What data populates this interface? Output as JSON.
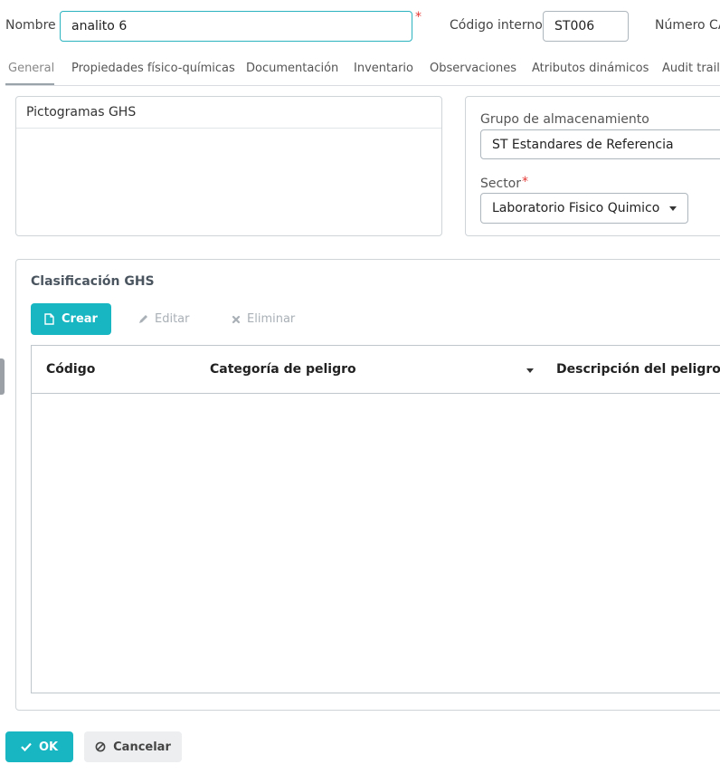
{
  "form": {
    "nombre_label": "Nombre",
    "nombre_value": "analito 6",
    "required_mark": "*",
    "codigo_label": "Código interno",
    "codigo_value": "ST006",
    "numero_label": "Número CA"
  },
  "tabs": [
    {
      "label": "General",
      "active": true
    },
    {
      "label": "Propiedades físico-químicas"
    },
    {
      "label": "Documentación"
    },
    {
      "label": "Inventario"
    },
    {
      "label": "Observaciones"
    },
    {
      "label": "Atributos dinámicos"
    },
    {
      "label": "Audit trail"
    }
  ],
  "pictogramas": {
    "title": "Pictogramas GHS"
  },
  "almacenamiento": {
    "grupo_label": "Grupo de almacenamiento",
    "grupo_value": "ST Estandares de Referencia",
    "sector_label": "Sector",
    "sector_required": "*",
    "sector_value": "Laboratorio Fisico Quimico"
  },
  "clasificacion": {
    "title": "Clasificación GHS",
    "crear_label": "Crear",
    "editar_label": "Editar",
    "eliminar_label": "Eliminar",
    "columns": [
      "Código",
      "Categoría de peligro",
      "Descripción del peligro"
    ]
  },
  "footer": {
    "ok_label": "OK",
    "cancel_label": "Cancelar"
  },
  "colors": {
    "accent": "#17b6c2",
    "required": "#e53935"
  }
}
